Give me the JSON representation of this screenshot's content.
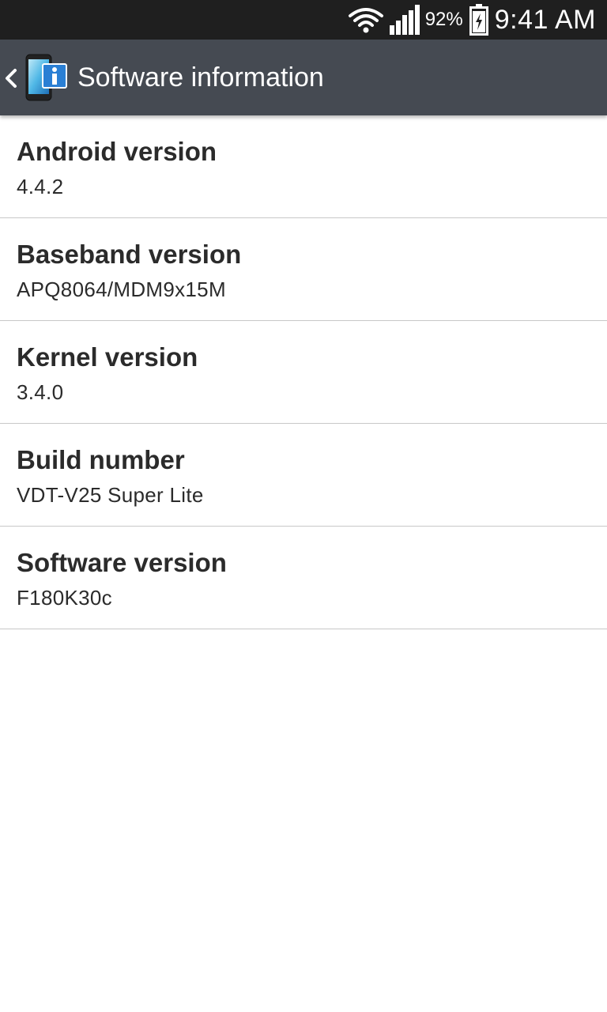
{
  "status_bar": {
    "battery_percent": "92%",
    "time": "9:41 AM",
    "icons": [
      "wifi-icon",
      "signal-icon",
      "battery-charging-icon"
    ]
  },
  "action_bar": {
    "title": "Software information",
    "icon": "software-info-icon"
  },
  "items": [
    {
      "title": "Android version",
      "value": "4.4.2"
    },
    {
      "title": "Baseband version",
      "value": "APQ8064/MDM9x15M"
    },
    {
      "title": "Kernel version",
      "value": "3.4.0"
    },
    {
      "title": "Build number",
      "value": "VDT-V25 Super Lite"
    },
    {
      "title": "Software version",
      "value": "F180K30c"
    }
  ],
  "colors": {
    "status_bar": "#1f1f1f",
    "action_bar": "#454a52",
    "background": "#ffffff",
    "divider": "#c8c8c8",
    "text": "#2b2b2b"
  }
}
